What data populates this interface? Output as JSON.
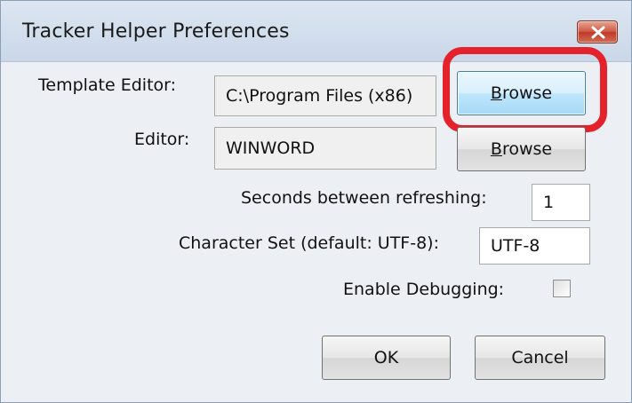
{
  "window": {
    "title": "Tracker Helper Preferences"
  },
  "template_editor": {
    "label": "Template Editor:",
    "value": "C:\\Program Files (x86)",
    "browse_prefix": "",
    "browse_accel": "B",
    "browse_rest": "rowse"
  },
  "editor": {
    "label": "Editor:",
    "value": "WINWORD",
    "browse_accel": "B",
    "browse_rest": "rowse"
  },
  "refresh": {
    "label": "Seconds between refreshing:",
    "value": "1"
  },
  "charset": {
    "label": "Character Set (default: UTF-8):",
    "value": "UTF-8"
  },
  "debugging": {
    "label": "Enable Debugging:",
    "checked": false
  },
  "buttons": {
    "ok": "OK",
    "cancel": "Cancel"
  },
  "colors": {
    "highlight": "#e3222b",
    "close_button": "#c7432e",
    "focused_button_border": "#3c7fb1"
  }
}
